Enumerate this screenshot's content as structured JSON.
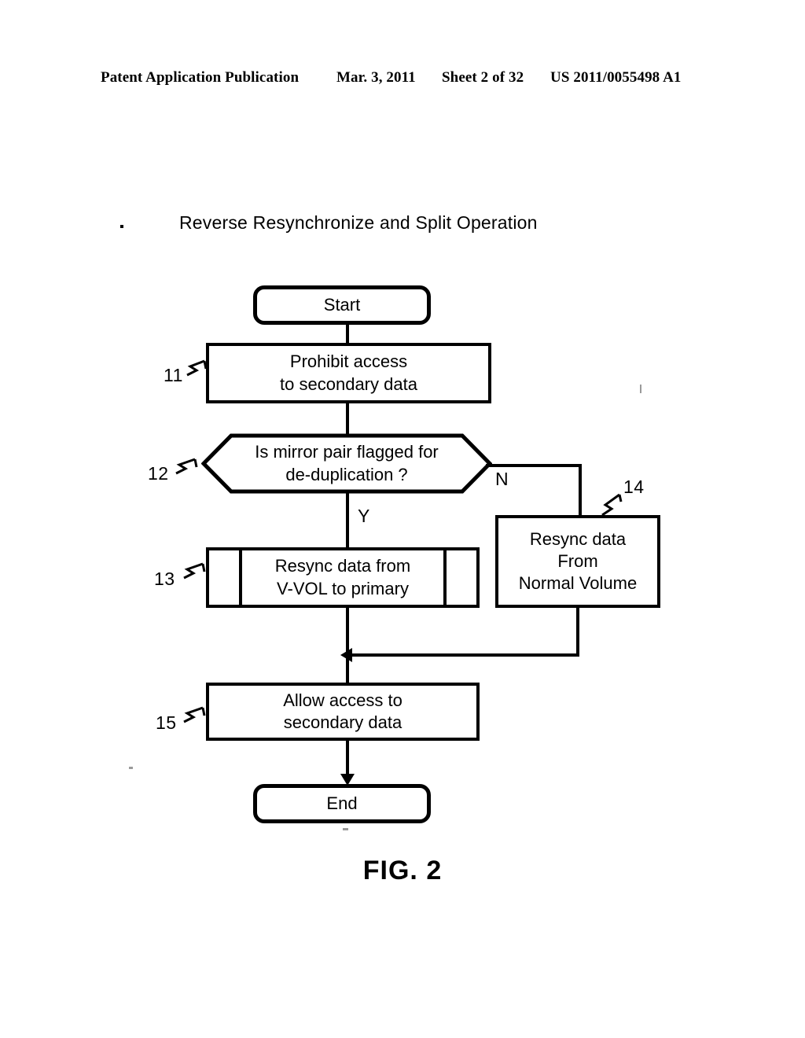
{
  "header": {
    "publication": "Patent Application Publication",
    "date": "Mar. 3, 2011",
    "sheet": "Sheet 2 of 32",
    "number": "US 2011/0055498 A1"
  },
  "figure": {
    "title": "Reverse Resynchronize and Split Operation",
    "caption": "FIG. 2"
  },
  "flowchart": {
    "nodes": {
      "start": {
        "label": "Start",
        "shape": "terminal"
      },
      "step11": {
        "ref": "11",
        "line1": "Prohibit access",
        "line2": "to secondary data",
        "shape": "process"
      },
      "step12": {
        "ref": "12",
        "line1": "Is mirror pair flagged for",
        "line2": "de-duplication ?",
        "shape": "decision"
      },
      "step13": {
        "ref": "13",
        "line1": "Resync data from",
        "line2": "V-VOL to primary",
        "shape": "predefined-process"
      },
      "step14": {
        "ref": "14",
        "line1": "Resync data",
        "line2": "From",
        "line3": "Normal Volume",
        "shape": "process"
      },
      "step15": {
        "ref": "15",
        "line1": "Allow access to",
        "line2": "secondary data",
        "shape": "process"
      },
      "end": {
        "label": "End",
        "shape": "terminal"
      }
    },
    "branches": {
      "yes": "Y",
      "no": "N"
    },
    "colors": {
      "stroke": "#000000",
      "fill": "#ffffff"
    }
  }
}
